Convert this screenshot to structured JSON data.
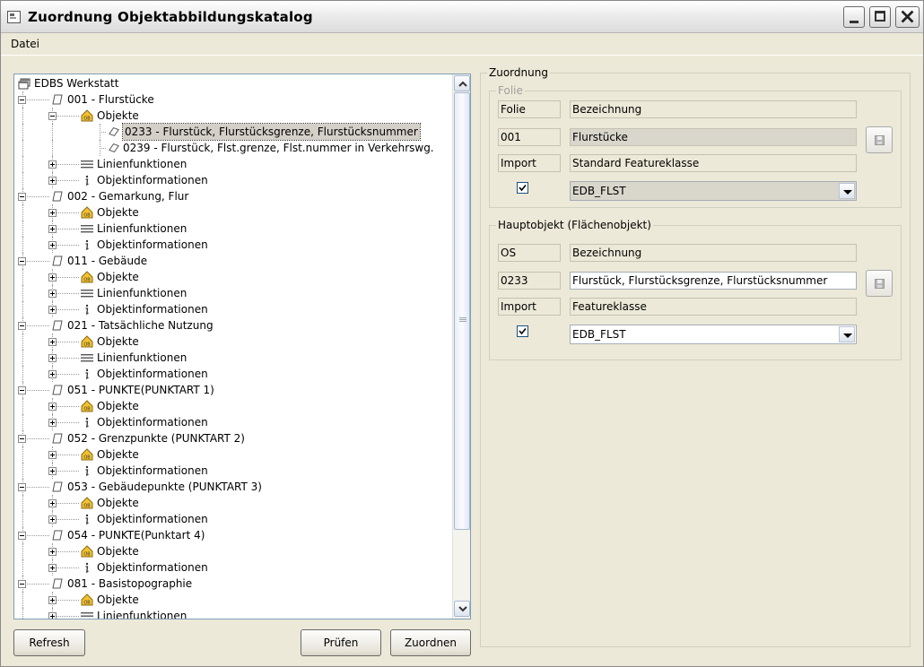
{
  "window": {
    "title": "Zuordnung Objektabbildungskatalog"
  },
  "menu": {
    "datei": "Datei"
  },
  "tree": {
    "nodes": [
      {
        "label": "EDBS Werkstatt",
        "level": 0,
        "icon": "windows-icon",
        "expander": "none"
      },
      {
        "label": "001 - Flurstücke",
        "level": 1,
        "icon": "folie-icon",
        "expander": "minus"
      },
      {
        "label": "Objekte",
        "level": 2,
        "icon": "objekte-icon",
        "expander": "minus"
      },
      {
        "label": "0233 - Flurstück, Flurstücksgrenze, Flurstücksnummer",
        "level": 3,
        "icon": "polygon-icon",
        "expander": "none",
        "selected": true
      },
      {
        "label": "0239 - Flurstück, Flst.grenze, Flst.nummer in Verkehrswg.",
        "level": 3,
        "icon": "polygon-icon",
        "expander": "none"
      },
      {
        "label": "Linienfunktionen",
        "level": 2,
        "icon": "lines-icon",
        "expander": "plus"
      },
      {
        "label": "Objektinformationen",
        "level": 2,
        "icon": "info-icon",
        "expander": "plus"
      },
      {
        "label": "002 - Gemarkung, Flur",
        "level": 1,
        "icon": "folie-icon",
        "expander": "minus"
      },
      {
        "label": "Objekte",
        "level": 2,
        "icon": "objekte-icon",
        "expander": "plus"
      },
      {
        "label": "Linienfunktionen",
        "level": 2,
        "icon": "lines-icon",
        "expander": "plus"
      },
      {
        "label": "Objektinformationen",
        "level": 2,
        "icon": "info-icon",
        "expander": "plus"
      },
      {
        "label": "011 - Gebäude",
        "level": 1,
        "icon": "folie-icon",
        "expander": "minus"
      },
      {
        "label": "Objekte",
        "level": 2,
        "icon": "objekte-icon",
        "expander": "plus"
      },
      {
        "label": "Linienfunktionen",
        "level": 2,
        "icon": "lines-icon",
        "expander": "plus"
      },
      {
        "label": "Objektinformationen",
        "level": 2,
        "icon": "info-icon",
        "expander": "plus"
      },
      {
        "label": "021 - Tatsächliche Nutzung",
        "level": 1,
        "icon": "folie-icon",
        "expander": "minus"
      },
      {
        "label": "Objekte",
        "level": 2,
        "icon": "objekte-icon",
        "expander": "plus"
      },
      {
        "label": "Linienfunktionen",
        "level": 2,
        "icon": "lines-icon",
        "expander": "plus"
      },
      {
        "label": "Objektinformationen",
        "level": 2,
        "icon": "info-icon",
        "expander": "plus"
      },
      {
        "label": "051 - PUNKTE(PUNKTART 1)",
        "level": 1,
        "icon": "folie-icon",
        "expander": "minus"
      },
      {
        "label": "Objekte",
        "level": 2,
        "icon": "objekte-icon",
        "expander": "plus"
      },
      {
        "label": "Objektinformationen",
        "level": 2,
        "icon": "info-icon",
        "expander": "plus"
      },
      {
        "label": "052 - Grenzpunkte (PUNKTART 2)",
        "level": 1,
        "icon": "folie-icon",
        "expander": "minus"
      },
      {
        "label": "Objekte",
        "level": 2,
        "icon": "objekte-icon",
        "expander": "plus"
      },
      {
        "label": "Objektinformationen",
        "level": 2,
        "icon": "info-icon",
        "expander": "plus"
      },
      {
        "label": "053 - Gebäudepunkte (PUNKTART 3)",
        "level": 1,
        "icon": "folie-icon",
        "expander": "minus"
      },
      {
        "label": "Objekte",
        "level": 2,
        "icon": "objekte-icon",
        "expander": "plus"
      },
      {
        "label": "Objektinformationen",
        "level": 2,
        "icon": "info-icon",
        "expander": "plus"
      },
      {
        "label": "054 - PUNKTE(Punktart 4)",
        "level": 1,
        "icon": "folie-icon",
        "expander": "minus"
      },
      {
        "label": "Objekte",
        "level": 2,
        "icon": "objekte-icon",
        "expander": "plus"
      },
      {
        "label": "Objektinformationen",
        "level": 2,
        "icon": "info-icon",
        "expander": "plus"
      },
      {
        "label": "081 - Basistopographie",
        "level": 1,
        "icon": "folie-icon",
        "expander": "minus"
      },
      {
        "label": "Objekte",
        "level": 2,
        "icon": "objekte-icon",
        "expander": "plus"
      },
      {
        "label": "Linienfunktionen",
        "level": 2,
        "icon": "lines-icon",
        "expander": "plus"
      }
    ]
  },
  "buttons": {
    "refresh": "Refresh",
    "pruefen": "Prüfen",
    "zuordnen": "Zuordnen"
  },
  "zuordnung": {
    "legend": "Zuordnung",
    "folie": {
      "legend": "Folie",
      "header_code": "Folie",
      "header_name": "Bezeichnung",
      "code": "001",
      "name": "Flurstücke",
      "import_label": "Import",
      "import_type": "Standard Featureklasse",
      "checked": true,
      "featureclass": "EDB_FLST"
    },
    "hauptobjekt": {
      "legend": "Hauptobjekt  (Flächenobjekt)",
      "header_code": "OS",
      "header_name": "Bezeichnung",
      "code": "0233",
      "name": "Flurstück, Flurstücksgrenze, Flurstücksnummer",
      "import_label": "Import",
      "import_type": "Featureklasse",
      "checked": true,
      "featureclass": "EDB_FLST"
    }
  },
  "colors": {
    "titlebar": "#e6e6e6",
    "dialog": "#ece9d8",
    "selection": "#d4d0c8",
    "tree_border": "#7f9db9"
  }
}
